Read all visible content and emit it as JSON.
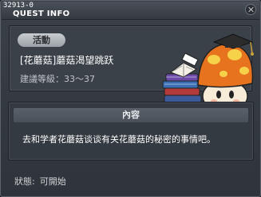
{
  "window": {
    "quest_id": "32913-0",
    "title": "QUEST INFO"
  },
  "quest": {
    "category": "活動",
    "name": "[花蘑菇]蘑菇渴望跳跃",
    "level_requirement": "建議等級：33～37",
    "npc_icon": "orange-mushroom-scholar-icon"
  },
  "content": {
    "header": "內容",
    "text": "去和学者花蘑菇谈谈有关花蘑菇的秘密的事情吧。"
  },
  "status": {
    "label": "狀態",
    "value": "可開始"
  },
  "colors": {
    "mushroom_cap": "#e8731f",
    "mushroom_spots": "#f6d24a",
    "book_blue": "#3a6fb4",
    "book_red": "#b23a3a"
  }
}
